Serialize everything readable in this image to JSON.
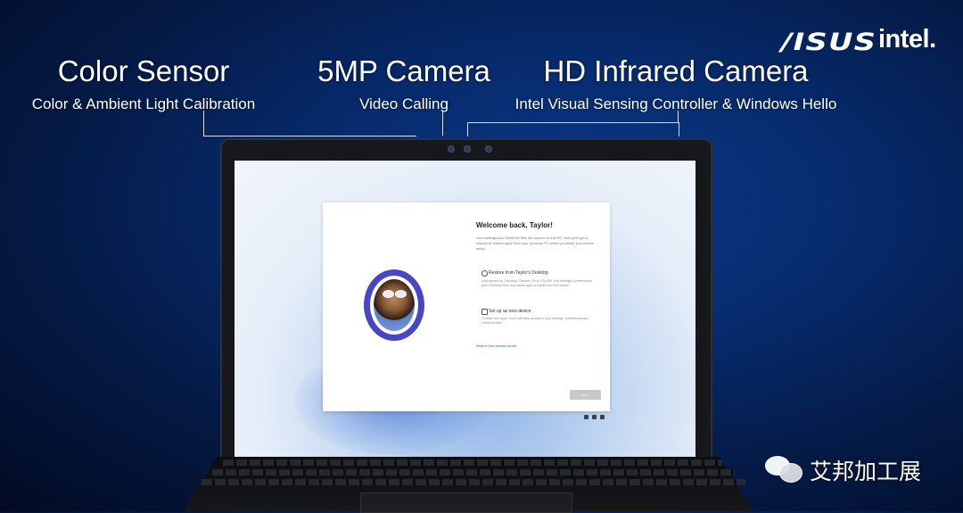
{
  "logos": {
    "asus": "/ISUS",
    "intel": "intel."
  },
  "callouts": {
    "color_sensor": {
      "title": "Color Sensor",
      "subtitle": "Color & Ambient Light Calibration"
    },
    "camera": {
      "title": "5MP Camera",
      "subtitle": "Video Calling"
    },
    "infrared": {
      "title": "HD Infrared Camera",
      "subtitle": "Intel Visual Sensing Controller & Windows Hello"
    }
  },
  "dialog": {
    "welcome": "Welcome back, Taylor!",
    "description": "Your settings and OneDrive files are synced to this PC, and you'll get a chance to restore apps from your previous PC when you finish your device setup.",
    "options": [
      {
        "icon": "restore-icon",
        "title": "Restore from Taylor's Desktop",
        "description": "Last synced on Thursday, October 7th at 3:24 AM. Use settings & preferences, your OneDrive files, and select apps to install from this device."
      },
      {
        "icon": "new-device-icon",
        "title": "Set up as new device",
        "description": "Choose new apps. You'll still have access to your settings, preferences and OneDrive files."
      }
    ],
    "other_device_link": "Restore from another device",
    "next_label": "Next"
  },
  "watermark": {
    "text": "艾邦加工展",
    "icon": "wechat-icon"
  },
  "colors": {
    "background": "#072a6b",
    "avatar_ring": "#4646c6",
    "link": "#2b5fb8"
  }
}
